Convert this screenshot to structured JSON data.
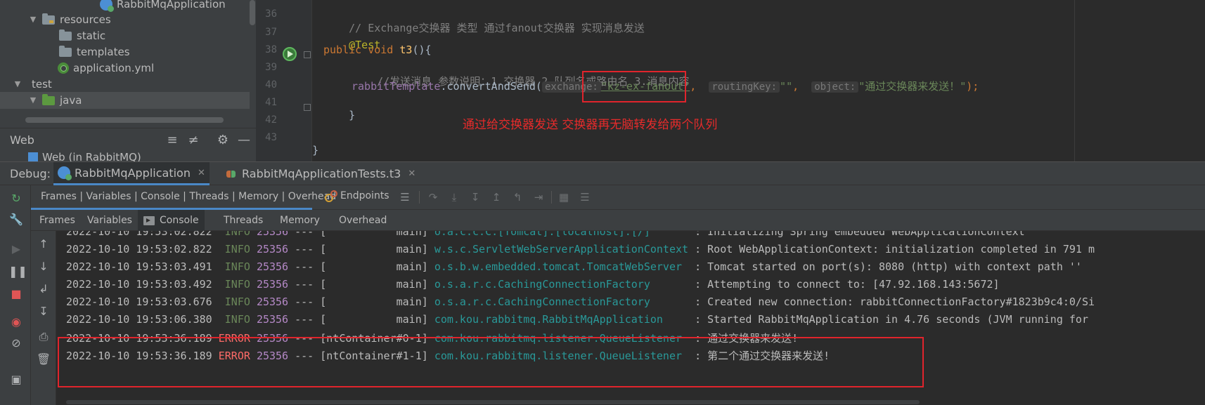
{
  "project_tree": {
    "items": [
      {
        "label": "RabbitMqApplication",
        "kind": "app"
      },
      {
        "label": "resources",
        "kind": "folder",
        "chevron": "down"
      },
      {
        "label": "static",
        "kind": "folder"
      },
      {
        "label": "templates",
        "kind": "folder"
      },
      {
        "label": "application.yml",
        "kind": "yml"
      },
      {
        "label": "test",
        "kind": "none",
        "chevron": "down"
      },
      {
        "label": "java",
        "kind": "folder-green",
        "chevron": "down"
      }
    ]
  },
  "services": {
    "title": "Web",
    "item": "Web (in RabbitMQ)",
    "icons": [
      "expand-all-icon",
      "collapse-all-icon",
      "gear-icon",
      "minimize-icon"
    ]
  },
  "editor": {
    "line_numbers": [
      "36",
      "37",
      "38",
      "39",
      "40",
      "41",
      "42",
      "43"
    ],
    "line36": {
      "comment": "// Exchange交换器 类型 通过fanout交换器 实现消息发送"
    },
    "line37": {
      "annotation": "@Test"
    },
    "line38": {
      "kw_public": "public",
      "kw_void": "void",
      "method": "t3",
      "rest": "(){"
    },
    "line39": {
      "comment": "//发送消息 参数说明：1.交换器 2.队列名或路由名 3.消息内容"
    },
    "line40": {
      "field": "rabbitTemplate",
      "call": ".convertAndSend(",
      "hint_exchange": "exchange:",
      "str_exchange": "\"kz-ex-fanout\"",
      "comma1": ",",
      "hint_routing": "routingKey:",
      "str_routing": "\"\"",
      "comma2": ",",
      "hint_object": "object:",
      "str_object": "\"通过交换器来发送！\"",
      "end": ");"
    },
    "line41": {
      "brace": "}"
    },
    "line43": {
      "brace": "}"
    },
    "annotation_note": "通过给交换器发送 交换器再无脑转发给两个队列"
  },
  "debug": {
    "label": "Debug:",
    "tabs": [
      {
        "label": "RabbitMqApplication",
        "active": true
      },
      {
        "label": "RabbitMqApplicationTests.t3",
        "active": false
      }
    ],
    "layout_label": "Frames | Variables | Console | Threads | Memory | Overhead",
    "endpoints_label": "Endpoints",
    "subtabs": [
      "Frames",
      "Variables",
      "Console",
      "Threads",
      "Memory",
      "Overhead"
    ],
    "active_subtab": "Console"
  },
  "console": {
    "lines": [
      {
        "ts": "2022-10-10 19:53:02.822",
        "level": "INFO",
        "pid": "25356",
        "sep": "---",
        "thread": "[           main]",
        "logger": "o.a.c.c.C.[Tomcat].[localhost].[/]      ",
        "msg": ": Initializing Spring embedded WebApplicationContext"
      },
      {
        "ts": "2022-10-10 19:53:02.822",
        "level": "INFO",
        "pid": "25356",
        "sep": "---",
        "thread": "[           main]",
        "logger": "w.s.c.ServletWebServerApplicationContext",
        "msg": ": Root WebApplicationContext: initialization completed in 791 m"
      },
      {
        "ts": "2022-10-10 19:53:03.491",
        "level": "INFO",
        "pid": "25356",
        "sep": "---",
        "thread": "[           main]",
        "logger": "o.s.b.w.embedded.tomcat.TomcatWebServer ",
        "msg": ": Tomcat started on port(s): 8080 (http) with context path ''"
      },
      {
        "ts": "2022-10-10 19:53:03.492",
        "level": "INFO",
        "pid": "25356",
        "sep": "---",
        "thread": "[           main]",
        "logger": "o.s.a.r.c.CachingConnectionFactory      ",
        "msg": ": Attempting to connect to: [47.92.168.143:5672]"
      },
      {
        "ts": "2022-10-10 19:53:03.676",
        "level": "INFO",
        "pid": "25356",
        "sep": "---",
        "thread": "[           main]",
        "logger": "o.s.a.r.c.CachingConnectionFactory      ",
        "msg": ": Created new connection: rabbitConnectionFactory#1823b9c4:0/Si"
      },
      {
        "ts": "2022-10-10 19:53:06.380",
        "level": "INFO",
        "pid": "25356",
        "sep": "---",
        "thread": "[           main]",
        "logger": "com.kou.rabbitmq.RabbitMqApplication    ",
        "msg": ": Started RabbitMqApplication in 4.76 seconds (JVM running for"
      },
      {
        "ts": "2022-10-10 19:53:36.189",
        "level": "ERROR",
        "pid": "25356",
        "sep": "---",
        "thread": "[ntContainer#0-1]",
        "logger": "com.kou.rabbitmq.listener.QueueListener ",
        "msg": ": 通过交换器来发送!"
      },
      {
        "ts": "2022-10-10 19:53:36.189",
        "level": "ERROR",
        "pid": "25356",
        "sep": "---",
        "thread": "[ntContainer#1-1]",
        "logger": "com.kou.rabbitmq.listener.QueueListener ",
        "msg": ": 第二个通过交换器来发送!"
      }
    ]
  },
  "colors": {
    "accent": "#4a88c7",
    "error": "#ff6b68",
    "info": "#6a8759",
    "highlight_box": "#e0242c"
  }
}
